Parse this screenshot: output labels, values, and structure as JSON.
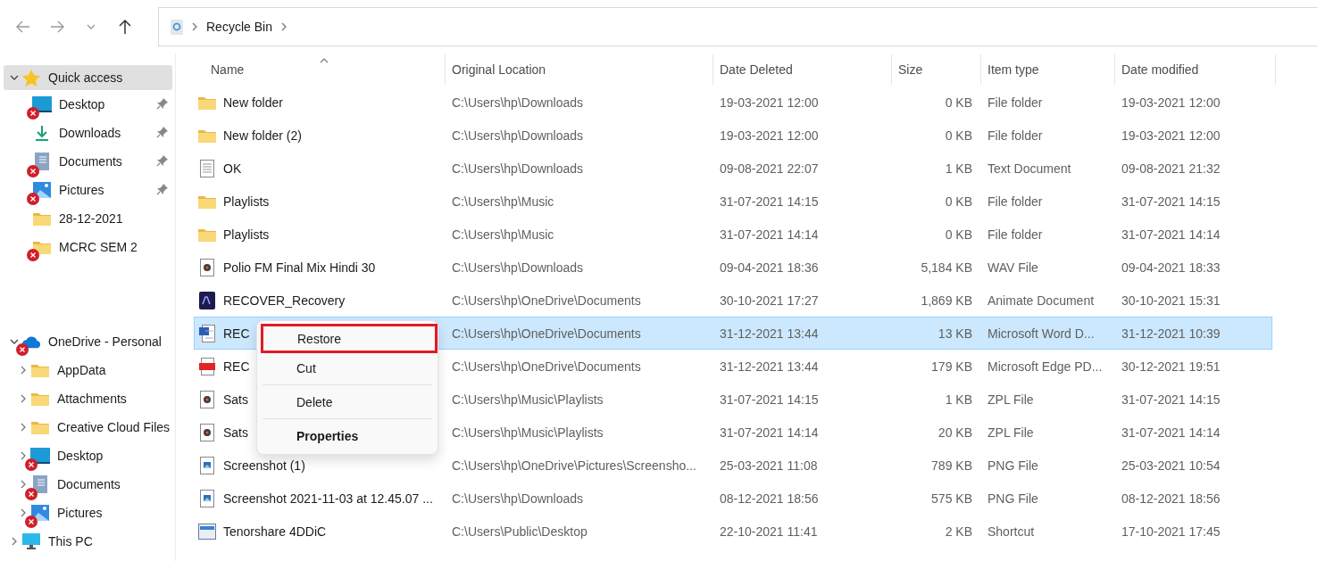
{
  "nav": {
    "buttons": [
      {
        "kind": "back",
        "disabled": true
      },
      {
        "kind": "forward",
        "disabled": true
      },
      {
        "kind": "recent",
        "disabled": true
      },
      {
        "kind": "up",
        "disabled": false
      }
    ]
  },
  "address": {
    "path": [
      "Recycle Bin"
    ]
  },
  "sidebar": {
    "items": [
      {
        "label": "Quick access",
        "kind": "star",
        "selected": true,
        "error": false,
        "expanded": true,
        "children": [
          {
            "label": "Desktop",
            "kind": "desktop",
            "selected": false,
            "error": true,
            "pinned": true
          },
          {
            "label": "Downloads",
            "kind": "download",
            "selected": false,
            "error": false,
            "pinned": true
          },
          {
            "label": "Documents",
            "kind": "documents",
            "selected": false,
            "error": true,
            "pinned": true
          },
          {
            "label": "Pictures",
            "kind": "pictures",
            "selected": false,
            "error": true,
            "pinned": true
          },
          {
            "label": "28-12-2021",
            "kind": "folder",
            "selected": false,
            "error": false,
            "pinned": false
          },
          {
            "label": "MCRC SEM 2",
            "kind": "folder",
            "selected": false,
            "error": true,
            "pinned": false
          }
        ]
      },
      {
        "label": "OneDrive - Personal",
        "kind": "cloud",
        "selected": false,
        "error": true,
        "expanded": true,
        "children": [
          {
            "label": "AppData",
            "kind": "folder",
            "selected": false,
            "error": false,
            "expanded": false
          },
          {
            "label": "Attachments",
            "kind": "folder",
            "selected": false,
            "error": false,
            "expanded": false
          },
          {
            "label": "Creative Cloud Files",
            "kind": "folder",
            "selected": false,
            "error": false,
            "expanded": false
          },
          {
            "label": "Desktop",
            "kind": "desktop",
            "selected": false,
            "error": true,
            "expanded": false
          },
          {
            "label": "Documents",
            "kind": "documents",
            "selected": false,
            "error": true,
            "expanded": false
          },
          {
            "label": "Pictures",
            "kind": "pictures",
            "selected": false,
            "error": true,
            "expanded": false
          }
        ]
      },
      {
        "label": "This PC",
        "kind": "pc",
        "selected": false,
        "error": false,
        "expanded": false
      }
    ]
  },
  "table": {
    "columns": [
      {
        "label": "Name",
        "sorted": true
      },
      {
        "label": "Original Location",
        "sorted": false
      },
      {
        "label": "Date Deleted",
        "sorted": false
      },
      {
        "label": "Size",
        "sorted": false
      },
      {
        "label": "Item type",
        "sorted": false
      },
      {
        "label": "Date modified",
        "sorted": false
      }
    ],
    "rows": [
      {
        "kind": "folder",
        "selected": false,
        "cells": [
          "New folder",
          "C:\\Users\\hp\\Downloads",
          "19-03-2021 12:00",
          "0 KB",
          "File folder",
          "19-03-2021 12:00"
        ]
      },
      {
        "kind": "folder",
        "selected": false,
        "cells": [
          "New folder (2)",
          "C:\\Users\\hp\\Downloads",
          "19-03-2021 12:00",
          "0 KB",
          "File folder",
          "19-03-2021 12:00"
        ]
      },
      {
        "kind": "text",
        "selected": false,
        "cells": [
          "OK",
          "C:\\Users\\hp\\Downloads",
          "09-08-2021 22:07",
          "1 KB",
          "Text Document",
          "09-08-2021 21:32"
        ]
      },
      {
        "kind": "folder",
        "selected": false,
        "cells": [
          "Playlists",
          "C:\\Users\\hp\\Music",
          "31-07-2021 14:15",
          "0 KB",
          "File folder",
          "31-07-2021 14:15"
        ]
      },
      {
        "kind": "folder",
        "selected": false,
        "cells": [
          "Playlists",
          "C:\\Users\\hp\\Music",
          "31-07-2021 14:14",
          "0 KB",
          "File folder",
          "31-07-2021 14:14"
        ]
      },
      {
        "kind": "audio",
        "selected": false,
        "cells": [
          "Polio FM Final Mix Hindi 30",
          "C:\\Users\\hp\\Downloads",
          "09-04-2021 18:36",
          "5,184 KB",
          "WAV File",
          "09-04-2021 18:33"
        ]
      },
      {
        "kind": "animate",
        "selected": false,
        "cells": [
          "RECOVER_Recovery",
          "C:\\Users\\hp\\OneDrive\\Documents",
          "30-10-2021 17:27",
          "1,869 KB",
          "Animate Document",
          "30-10-2021 15:31"
        ]
      },
      {
        "kind": "word",
        "selected": true,
        "cells": [
          "REC",
          "C:\\Users\\hp\\OneDrive\\Documents",
          "31-12-2021 13:44",
          "13 KB",
          "Microsoft Word D...",
          "31-12-2021 10:39"
        ]
      },
      {
        "kind": "pdf",
        "selected": false,
        "cells": [
          "REC",
          "C:\\Users\\hp\\OneDrive\\Documents",
          "31-12-2021 13:44",
          "179 KB",
          "Microsoft Edge PD...",
          "30-12-2021 19:51"
        ]
      },
      {
        "kind": "audio",
        "selected": false,
        "cells": [
          "Sats",
          "C:\\Users\\hp\\Music\\Playlists",
          "31-07-2021 14:15",
          "1 KB",
          "ZPL File",
          "31-07-2021 14:15"
        ]
      },
      {
        "kind": "audio",
        "selected": false,
        "cells": [
          "Sats",
          "C:\\Users\\hp\\Music\\Playlists",
          "31-07-2021 14:14",
          "20 KB",
          "ZPL File",
          "31-07-2021 14:14"
        ]
      },
      {
        "kind": "image",
        "selected": false,
        "cells": [
          "Screenshot (1)",
          "C:\\Users\\hp\\OneDrive\\Pictures\\Screensho...",
          "25-03-2021 11:08",
          "789 KB",
          "PNG File",
          "25-03-2021 10:54"
        ]
      },
      {
        "kind": "image",
        "selected": false,
        "cells": [
          "Screenshot 2021-11-03 at 12.45.07 ...",
          "C:\\Users\\hp\\Downloads",
          "08-12-2021 18:56",
          "575 KB",
          "PNG File",
          "08-12-2021 18:56"
        ]
      },
      {
        "kind": "shortcut",
        "selected": false,
        "cells": [
          "Tenorshare 4DDiC",
          "C:\\Users\\Public\\Desktop",
          "22-10-2021 11:41",
          "2 KB",
          "Shortcut",
          "17-10-2021 17:45"
        ]
      }
    ]
  },
  "context_menu": {
    "items": [
      {
        "label": "Restore",
        "highlighted": true,
        "default": false,
        "separator_after": false
      },
      {
        "label": "Cut",
        "highlighted": false,
        "default": false,
        "separator_after": true
      },
      {
        "label": "Delete",
        "highlighted": false,
        "default": false,
        "separator_after": true
      },
      {
        "label": "Properties",
        "highlighted": false,
        "default": true,
        "separator_after": false
      }
    ]
  }
}
